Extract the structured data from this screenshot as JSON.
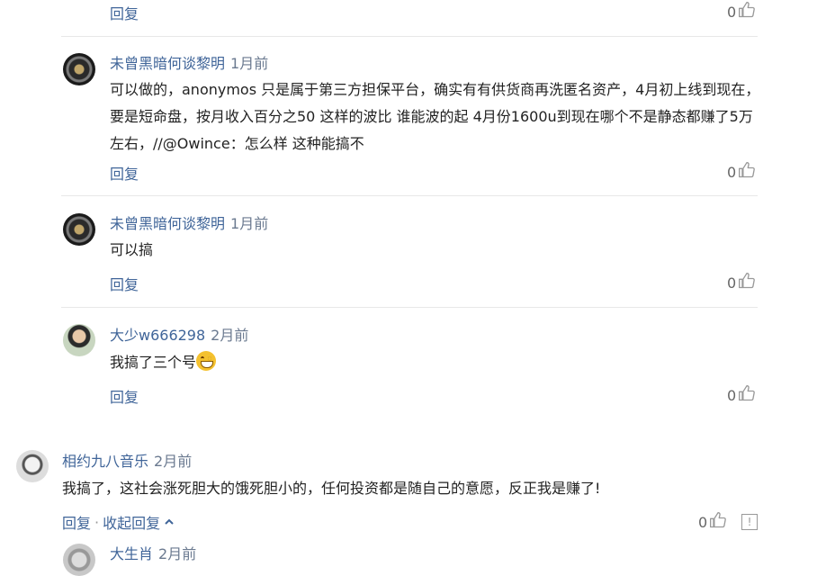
{
  "reply_label": "回复",
  "like_icon": "thumbs-up-icon",
  "top_row": {
    "like_count": "0"
  },
  "comments": [
    {
      "author": "未曾黑暗何谈黎明",
      "time": "1月前",
      "text": "可以做的，anonymos 只是属于第三方担保平台，确实有有供货商再洗匿名资产，4月初上线到现在，要是短命盘，按月收入百分之50 这样的波比 谁能波的起 4月份1600u到现在哪个不是静态都赚了5万左右，//@Owince：怎么样 这种能搞不",
      "like_count": "0"
    },
    {
      "author": "未曾黑暗何谈黎明",
      "time": "1月前",
      "text": "可以搞",
      "like_count": "0"
    },
    {
      "author": "大少w666298",
      "time": "2月前",
      "text": "我搞了三个号",
      "emoji": "grinning-face-emoji",
      "like_count": "0"
    }
  ],
  "main_comment": {
    "author": "相约九八音乐",
    "time": "2月前",
    "text": "我搞了，这社会涨死胆大的饿死胆小的，任何投资都是随自己的意愿，反正我是赚了!",
    "reply_label": "回复",
    "separator": "·",
    "collapse_label": "收起回复",
    "like_count": "0",
    "report_icon": "report-icon"
  },
  "next_comment": {
    "author": "大生肖",
    "time": "2月前"
  }
}
